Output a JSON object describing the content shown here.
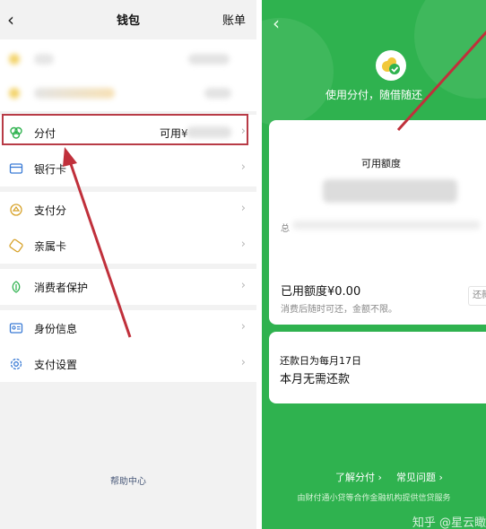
{
  "wallet": {
    "nav_title": "钱包",
    "nav_right": "账单",
    "menu": {
      "fenfu_label": "分付",
      "fenfu_available": "可用¥",
      "bank_card": "银行卡",
      "pay_score": "支付分",
      "family_card": "亲属卡",
      "consumer_protection": "消费者保护",
      "identity_info": "身份信息",
      "pay_settings": "支付设置"
    },
    "help_center": "帮助中心"
  },
  "fenfu": {
    "slogan": "使用分付，随借随还",
    "available_credit_label": "可用额度",
    "total_prefix": "总",
    "used_credit": "已用额度¥0.00",
    "used_credit_hint": "消费后随时可还，金额不限。",
    "repay_button": "还款",
    "repay_day": "还款日为每月17日",
    "repay_status": "本月无需还款",
    "learn_more": "了解分付",
    "faq": "常见问题",
    "provider_note": "由财付通小贷等合作金融机构提供信贷服务",
    "watermark": "知乎 @星云瞰"
  },
  "colors": {
    "green": "#2fb24f",
    "highlight": "#b83b46",
    "arrow": "#c0303b"
  }
}
